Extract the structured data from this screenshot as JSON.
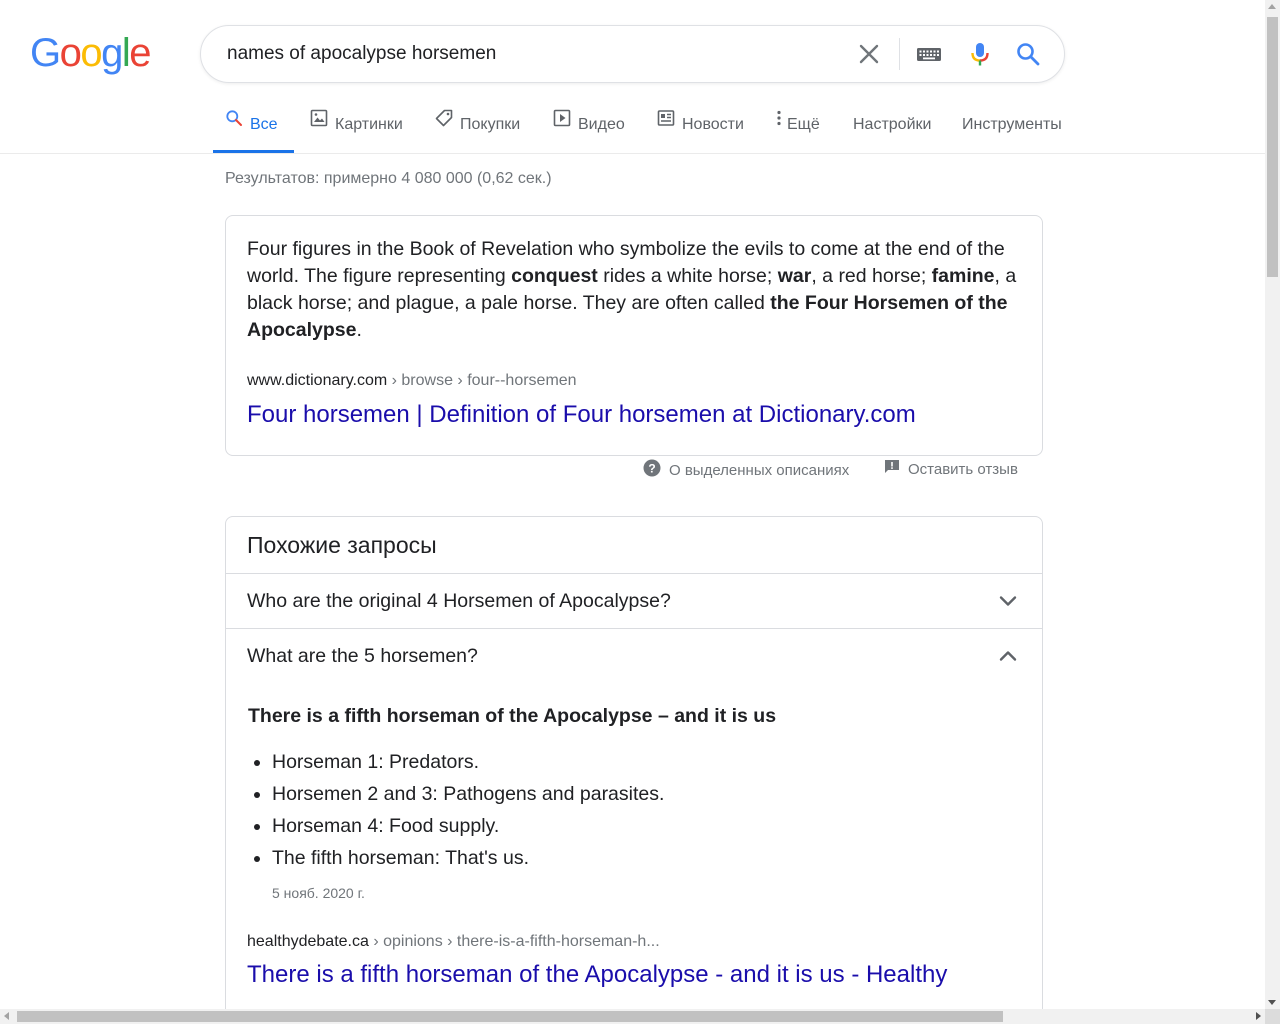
{
  "logo": {
    "letters": [
      "G",
      "o",
      "o",
      "g",
      "l",
      "e"
    ]
  },
  "colors": {
    "blue": "#4285F4",
    "red": "#EA4335",
    "yellow": "#FBBC05",
    "green": "#34A853",
    "link": "#1a0dab",
    "accent": "#1a73e8"
  },
  "search": {
    "query": "names of apocalypse horsemen",
    "icons": [
      "close-icon",
      "keyboard-icon",
      "microphone-icon",
      "search-icon"
    ]
  },
  "tabs": [
    {
      "label": "Все",
      "icon": "search-icon",
      "active": true
    },
    {
      "label": "Картинки",
      "icon": "image-icon"
    },
    {
      "label": "Покупки",
      "icon": "tag-icon"
    },
    {
      "label": "Видео",
      "icon": "play-icon"
    },
    {
      "label": "Новости",
      "icon": "news-icon"
    },
    {
      "label": "Ещё",
      "icon": "more-vert-icon"
    },
    {
      "label": "Настройки"
    },
    {
      "label": "Инструменты"
    }
  ],
  "stats": "Результатов: примерно 4 080 000 (0,62 сек.)",
  "snippet": {
    "parts": [
      {
        "t": "Four figures in the Book of Revelation who symbolize the evils to come at the end of the world. The figure representing "
      },
      {
        "t": "conquest",
        "b": true
      },
      {
        "t": " rides a white horse; "
      },
      {
        "t": "war",
        "b": true
      },
      {
        "t": ", a red horse; "
      },
      {
        "t": "famine",
        "b": true
      },
      {
        "t": ", a black horse; and plague, a pale horse. They are often called "
      },
      {
        "t": "the Four Horsemen of the Apocalypse",
        "b": true
      },
      {
        "t": "."
      }
    ],
    "cite_domain": "www.dictionary.com",
    "cite_path": " › browse › four--horsemen",
    "title": "Four horsemen | Definition of Four horsemen at Dictionary.com"
  },
  "feedback": {
    "about": "О выделенных описаниях",
    "report": "Оставить отзыв"
  },
  "related": {
    "title": "Похожие запросы",
    "questions": [
      {
        "q": "Who are the original 4 Horsemen of Apocalypse?",
        "expanded": false
      },
      {
        "q": "What are the 5 horsemen?",
        "expanded": true
      }
    ],
    "answer": {
      "heading": "There is a fifth horseman of the Apocalypse – and it is us",
      "items": [
        "Horseman 1: Predators.",
        "Horsemen 2 and 3: Pathogens and parasites.",
        "Horseman 4: Food supply.",
        "The fifth horseman: That's us."
      ],
      "date": "5 нояб. 2020 г.",
      "cite_domain": "healthydebate.ca",
      "cite_path": " › opinions › there-is-a-fifth-horseman-h...",
      "title": "There is a fifth horseman of the Apocalypse - and it is us - Healthy"
    }
  }
}
